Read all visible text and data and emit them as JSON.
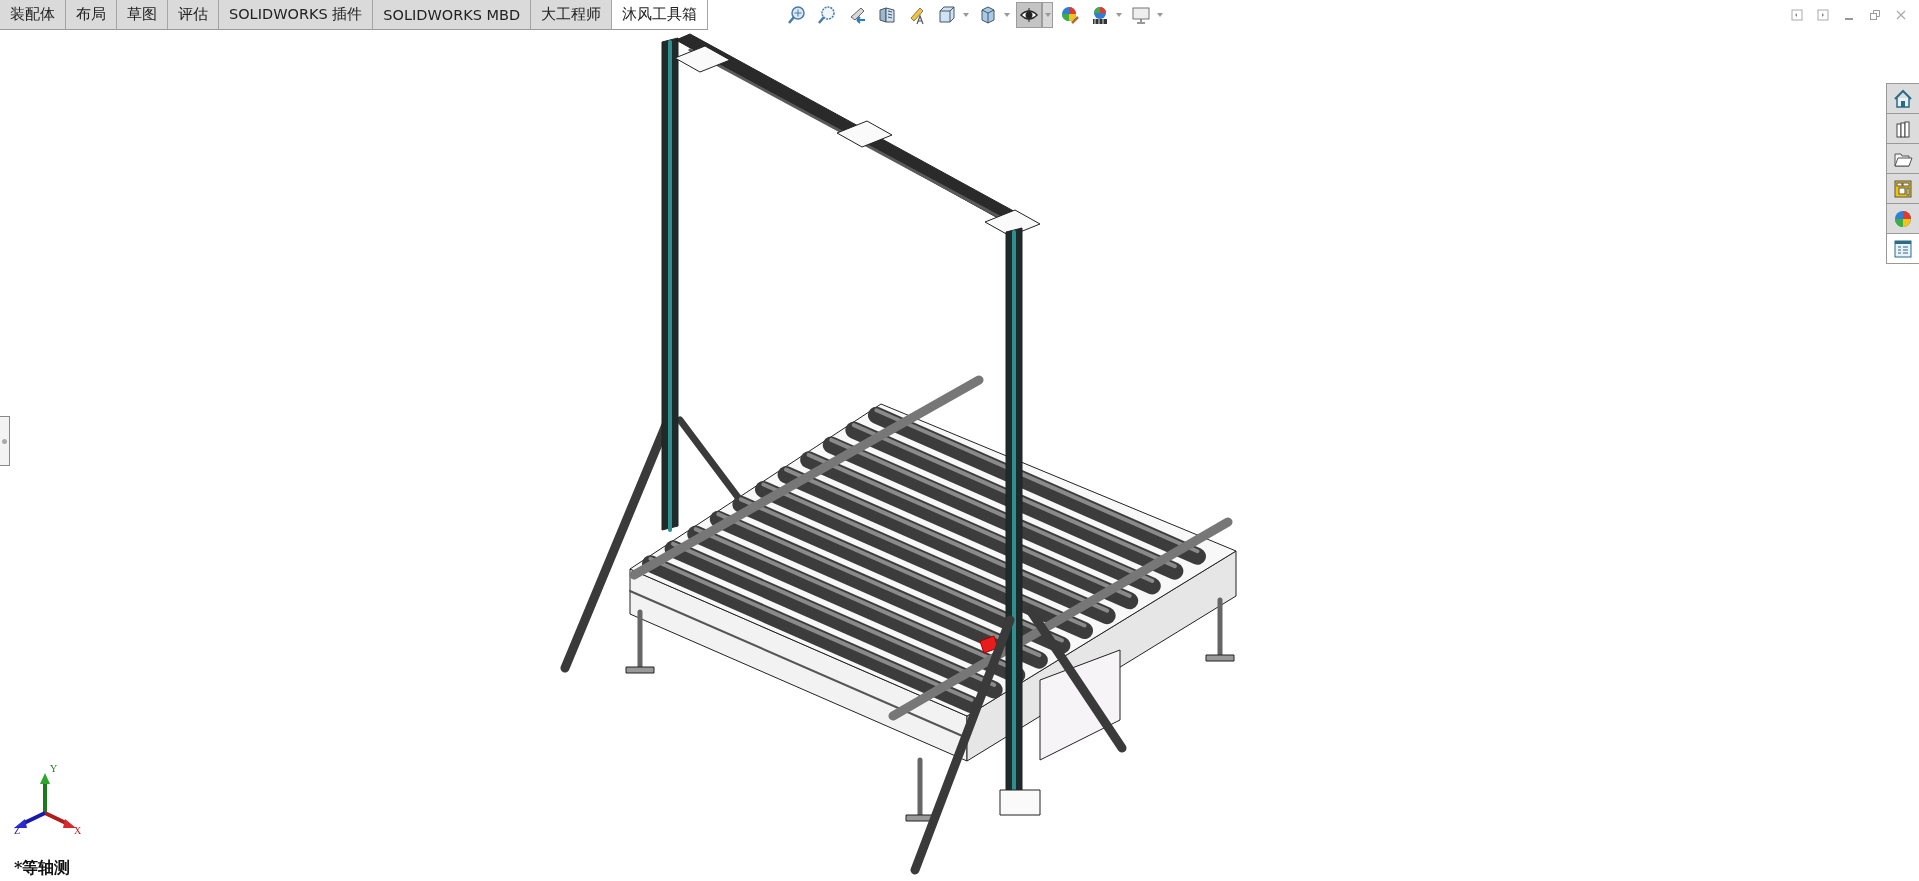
{
  "tabs": [
    {
      "label": "装配体",
      "selected": false
    },
    {
      "label": "布局",
      "selected": false
    },
    {
      "label": "草图",
      "selected": false
    },
    {
      "label": "评估",
      "selected": false
    },
    {
      "label": "SOLIDWORKS 插件",
      "selected": false
    },
    {
      "label": "SOLIDWORKS MBD",
      "selected": false
    },
    {
      "label": "大工程师",
      "selected": false
    },
    {
      "label": "沐风工具箱",
      "selected": true
    }
  ],
  "view_toolbar": [
    {
      "pressed": false,
      "dropdown": false
    },
    {
      "pressed": false,
      "dropdown": false
    },
    {
      "pressed": false,
      "dropdown": false
    },
    {
      "pressed": false,
      "dropdown": false
    },
    {
      "pressed": false,
      "dropdown": false
    },
    {
      "pressed": false,
      "dropdown": true
    },
    {
      "pressed": false,
      "dropdown": true
    },
    {
      "pressed": true,
      "dropdown": true
    },
    {
      "pressed": false,
      "dropdown": false
    },
    {
      "pressed": false,
      "dropdown": true
    },
    {
      "pressed": false,
      "dropdown": true
    }
  ],
  "triad": {
    "x": "X",
    "y": "Y",
    "z": "Z"
  },
  "view_label": "*等轴测"
}
